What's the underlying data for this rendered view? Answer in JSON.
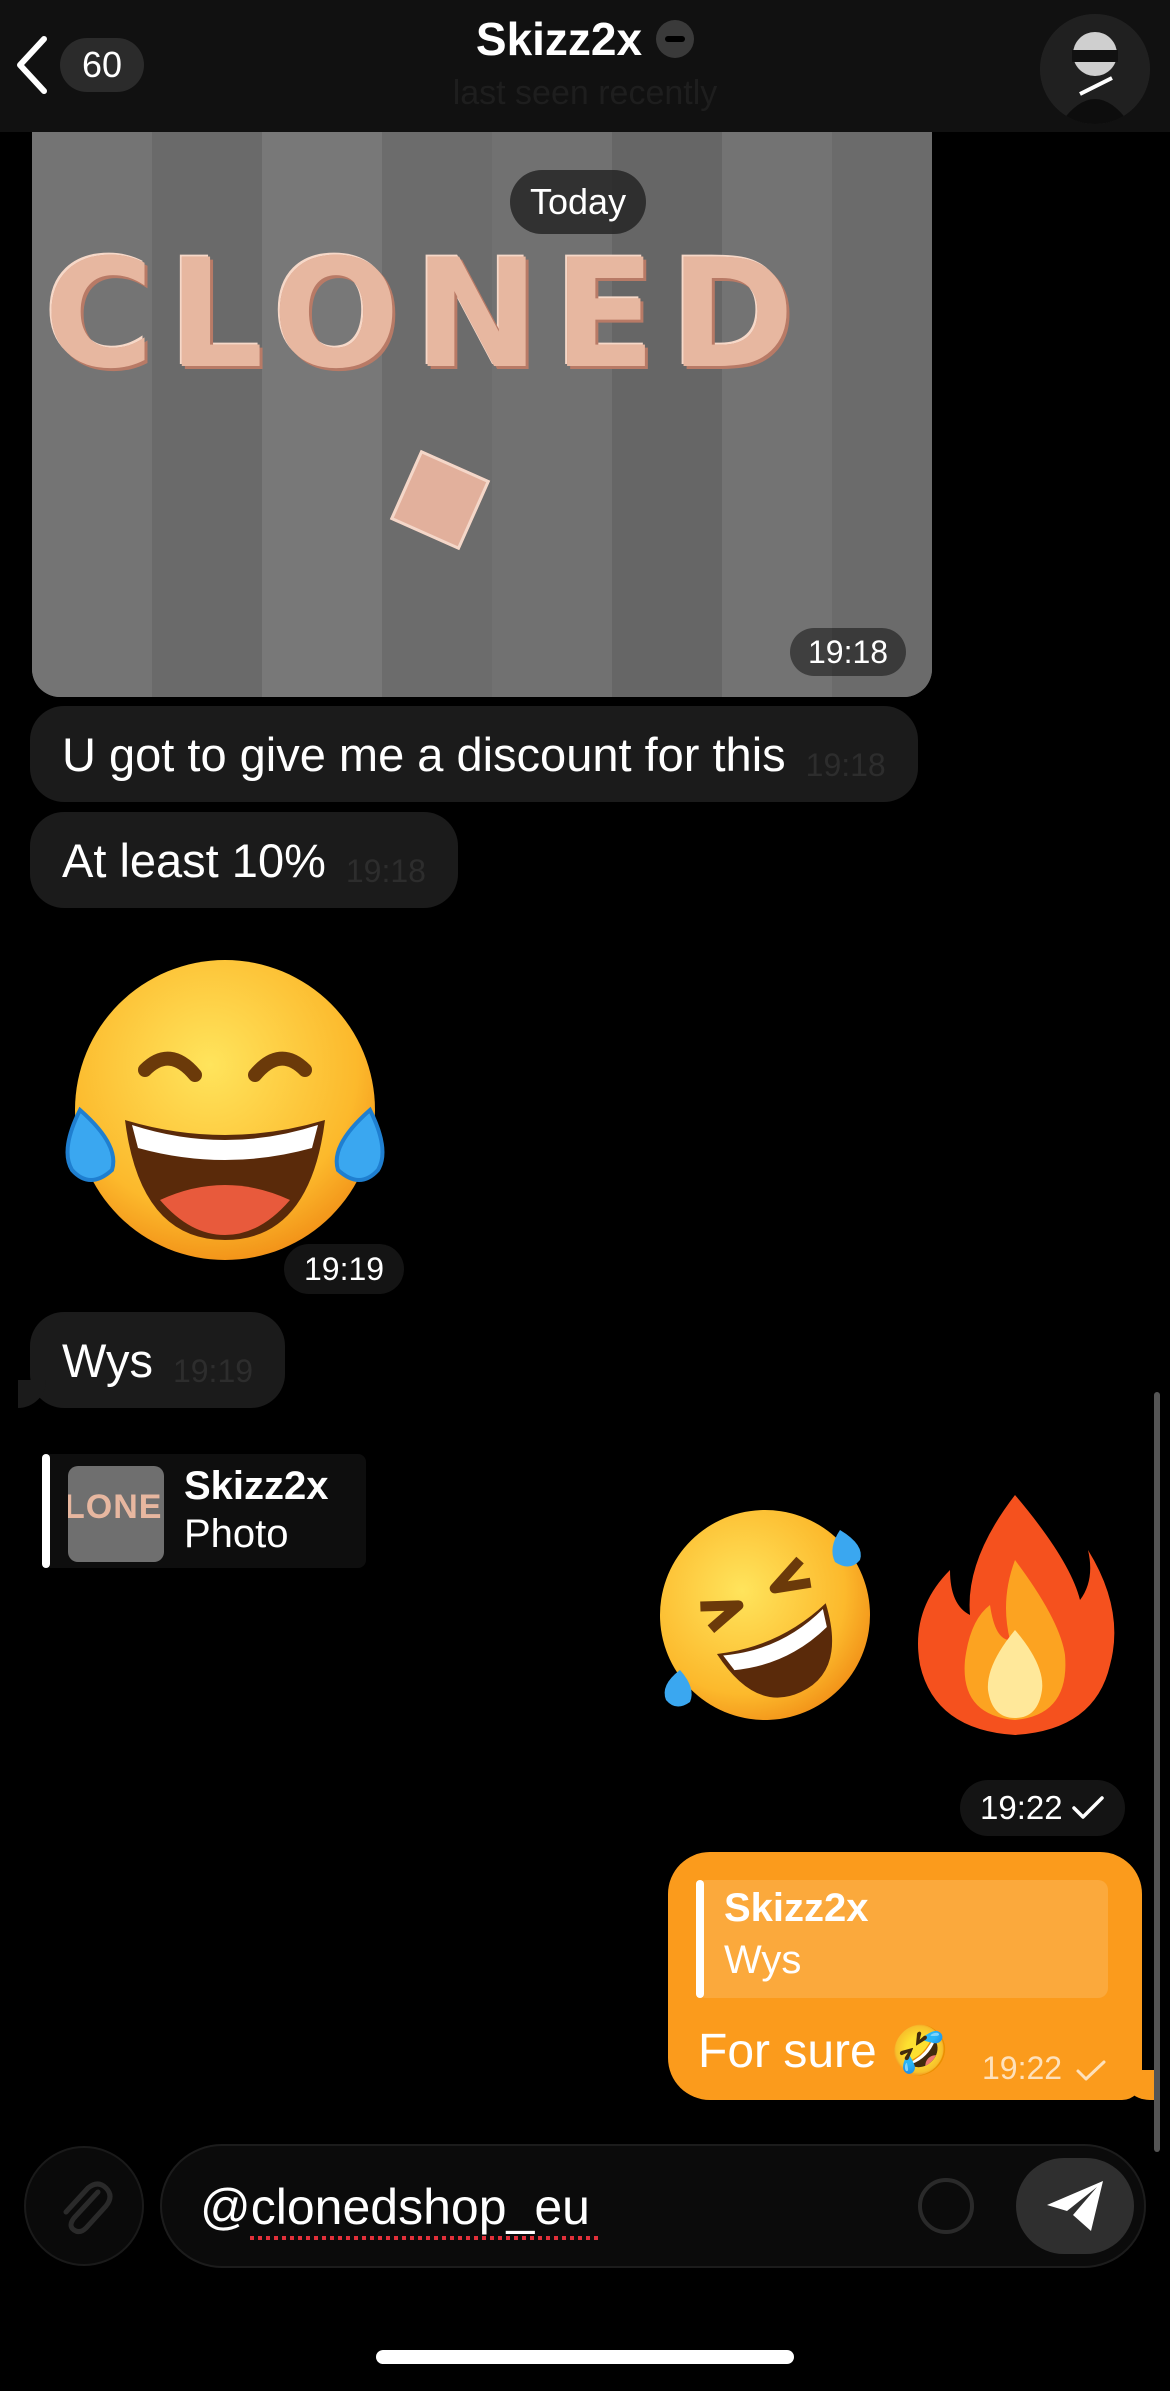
{
  "header": {
    "back_count": "60",
    "title": "Skizz2x",
    "status": "last seen recently",
    "muted_icon": "minus-circle-icon",
    "avatar_icon": "avatar-image"
  },
  "date_chip": "Today",
  "photo_message": {
    "image_text": "CLONED",
    "time": "19:18"
  },
  "messages": [
    {
      "text": "U got to give me a discount for this",
      "time": "19:18"
    },
    {
      "text": "At least 10%",
      "time": "19:18"
    },
    {
      "emoji": "😂",
      "time": "19:19"
    },
    {
      "text": "Wys",
      "time": "19:19"
    }
  ],
  "reply_preview": {
    "name": "Skizz2x",
    "subtitle": "Photo",
    "thumb_text": "LONED"
  },
  "outgoing_emoji": {
    "emojis": [
      "🤣",
      "🔥"
    ],
    "time": "19:22",
    "status_icon": "check-icon"
  },
  "outgoing_message": {
    "quote_name": "Skizz2x",
    "quote_text": "Wys",
    "text": "For sure 🤣",
    "time": "19:22",
    "status_icon": "check-icon"
  },
  "composer": {
    "value": "@clonedshop_eu",
    "attach_icon": "paperclip-icon",
    "emoji_icon": "smiley-icon",
    "send_icon": "paper-plane-icon"
  },
  "colors": {
    "accent": "#fb9b1c",
    "incoming_bubble": "#1b1b1b",
    "background": "#000000"
  }
}
